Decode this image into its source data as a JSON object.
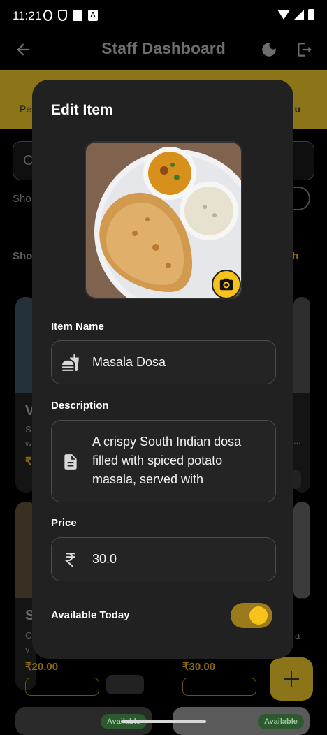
{
  "status_bar": {
    "time": "11:21",
    "app_indicator": "A"
  },
  "app_bar": {
    "title": "Staff Dashboard"
  },
  "background": {
    "tab_left_fragment": "Pe",
    "tab_right_fragment": "u",
    "search_fragment": "C",
    "row1_fragment": "Sho",
    "row2_fragment": "Sho",
    "row2_right_fragment": "h",
    "card1_title_fragment": "V",
    "card1_desc_fragment_a": "S",
    "card1_desc_fragment_b": "w",
    "card1_price_fragment": "₹",
    "card2_desc_fragment": "...",
    "card3_title_fragment": "S",
    "card3_desc_fragment_a": "C",
    "card3_desc_fragment_b": "v",
    "card3_price": "₹20.00",
    "card4_price": "₹30.00",
    "card4_desc_fragment": "a",
    "badge_label": "Available"
  },
  "dialog": {
    "title": "Edit Item",
    "item_name_label": "Item Name",
    "item_name_value": "Masala Dosa",
    "description_label": "Description",
    "description_value": "A crispy South Indian dosa filled with spiced potato masala, served with",
    "price_label": "Price",
    "price_value": "30.0",
    "available_label": "Available Today",
    "available": true
  },
  "colors": {
    "accent": "#f7c21c",
    "dialog_bg": "#212121",
    "field_border": "#4c4c4c",
    "scrim_accent": "#8c7419"
  },
  "icons": {
    "back": "arrow-left-icon",
    "theme": "moon-icon",
    "logout": "logout-icon",
    "camera": "camera-icon",
    "item_name": "fastfood-icon",
    "description": "description-icon",
    "price": "rupee-icon",
    "fab": "plus-icon"
  }
}
